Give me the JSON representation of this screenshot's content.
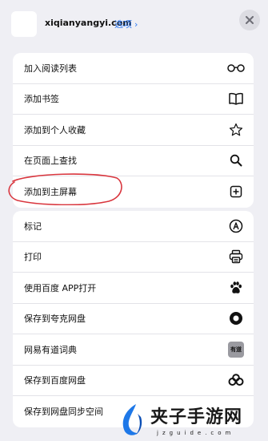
{
  "header": {
    "site": "xiqianyangyi.com",
    "options_label": "选项",
    "options_chevron": "›"
  },
  "menu_group_1": [
    {
      "label": "加入阅读列表",
      "icon": "reading-glasses-icon"
    },
    {
      "label": "添加书签",
      "icon": "book-icon"
    },
    {
      "label": "添加到个人收藏",
      "icon": "star-icon"
    },
    {
      "label": "在页面上查找",
      "icon": "search-icon"
    },
    {
      "label": "添加到主屏幕",
      "icon": "plus-square-icon"
    }
  ],
  "menu_group_2": [
    {
      "label": "标记",
      "icon": "markup-icon"
    },
    {
      "label": "打印",
      "icon": "printer-icon"
    },
    {
      "label": "使用百度 APP打开",
      "icon": "baidu-paw-icon"
    },
    {
      "label": "保存到夸克网盘",
      "icon": "quark-icon"
    },
    {
      "label": "网易有道词典",
      "icon": "youdao-icon",
      "badge": "有道"
    },
    {
      "label": "保存到百度网盘",
      "icon": "baidu-netdisk-icon"
    },
    {
      "label": "保存到网盘同步空间",
      "icon": "sync-space-icon"
    }
  ],
  "annotation": {
    "color": "#d9363e",
    "target": "添加到主屏幕"
  },
  "watermark": {
    "text": "夹子手游网",
    "subtext": "jzguide.com"
  },
  "colors": {
    "link": "#2f7bf5",
    "background": "#efeff4",
    "card": "#ffffff"
  }
}
